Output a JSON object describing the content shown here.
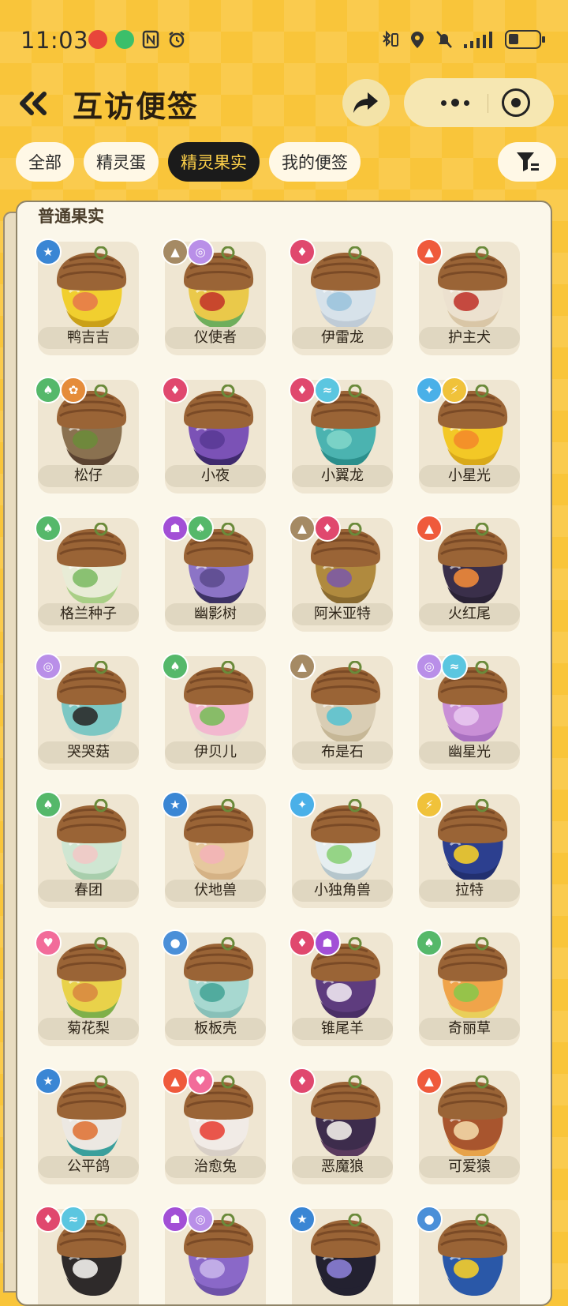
{
  "status_bar": {
    "time": "11:03"
  },
  "nav": {
    "title": "互访便签"
  },
  "tabs": [
    {
      "label": "全部",
      "active": false
    },
    {
      "label": "精灵蛋",
      "active": false
    },
    {
      "label": "精灵果实",
      "active": true
    },
    {
      "label": "我的便签",
      "active": false
    }
  ],
  "section_title": "普通果实",
  "colors": {
    "grass": "#55b86a",
    "water": "#4a8fd8",
    "fire": "#ef5a3c",
    "normal": "#3a86d4",
    "ghost": "#a24fd6",
    "demon": "#e0486e",
    "ice": "#4ab0e8",
    "electric": "#f0c23a",
    "ground": "#a58a64",
    "wind": "#5bc6e0",
    "illusion": "#b98fe8",
    "cute": "#f26c9a",
    "mech": "#e58c3a"
  },
  "fruits": [
    {
      "name": "鸭吉吉",
      "types": [
        "normal"
      ],
      "body": "#f1cf2f",
      "mark": "#e77a4a",
      "bottom": "#caa018"
    },
    {
      "name": "仪使者",
      "types": [
        "ground",
        "illusion"
      ],
      "body": "#eac94a",
      "mark": "#c4382a",
      "bottom": "#6fae5c"
    },
    {
      "name": "伊雷龙",
      "types": [
        "demon"
      ],
      "body": "#d7e2ea",
      "mark": "#9cc4dd",
      "bottom": "#bfcbd6"
    },
    {
      "name": "护主犬",
      "types": [
        "fire"
      ],
      "body": "#ece1cf",
      "mark": "#c1392f",
      "bottom": "#d9c6a6"
    },
    {
      "name": "松仔",
      "types": [
        "grass",
        "mech"
      ],
      "body": "#8a7150",
      "mark": "#6c8b3a",
      "bottom": "#5b4331"
    },
    {
      "name": "小夜",
      "types": [
        "demon"
      ],
      "body": "#7b52b6",
      "mark": "#5a3a96",
      "bottom": "#3f2a6e"
    },
    {
      "name": "小翼龙",
      "types": [
        "demon",
        "wind"
      ],
      "body": "#4bb3b0",
      "mark": "#7fd5c9",
      "bottom": "#2b8f8c"
    },
    {
      "name": "小星光",
      "types": [
        "ice",
        "electric"
      ],
      "body": "#f3c826",
      "mark": "#f48b2a",
      "bottom": "#d9a91a"
    },
    {
      "name": "格兰种子",
      "types": [
        "grass"
      ],
      "body": "#e8ecd6",
      "mark": "#7fbd67",
      "bottom": "#a9cf86"
    },
    {
      "name": "幽影树",
      "types": [
        "ghost",
        "grass"
      ],
      "body": "#8c74c6",
      "mark": "#5d4d8f",
      "bottom": "#3d3266"
    },
    {
      "name": "阿米亚特",
      "types": [
        "ground",
        "demon"
      ],
      "body": "#b08a3e",
      "mark": "#7d5aa4",
      "bottom": "#8a6a2e"
    },
    {
      "name": "火红尾",
      "types": [
        "fire"
      ],
      "body": "#3a2f4a",
      "mark": "#f08a3a",
      "bottom": "#2a2236"
    },
    {
      "name": "哭哭菇",
      "types": [
        "illusion"
      ],
      "body": "#7cc7c3",
      "mark": "#2b2b2b",
      "bottom": "#e7e2d2"
    },
    {
      "name": "伊贝儿",
      "types": [
        "grass"
      ],
      "body": "#f2b8cf",
      "mark": "#7cbd5c",
      "bottom": "#e9e3d3"
    },
    {
      "name": "布是石",
      "types": [
        "ground"
      ],
      "body": "#d9cdb4",
      "mark": "#5bc3cf",
      "bottom": "#c6b796"
    },
    {
      "name": "幽星光",
      "types": [
        "illusion",
        "wind"
      ],
      "body": "#c98fd6",
      "mark": "#e8c6ef",
      "bottom": "#a970c0"
    },
    {
      "name": "春团",
      "types": [
        "grass"
      ],
      "body": "#cfe6d2",
      "mark": "#f1c9c7",
      "bottom": "#a8ceac"
    },
    {
      "name": "伏地兽",
      "types": [
        "normal"
      ],
      "body": "#e6c89e",
      "mark": "#f3b4b7",
      "bottom": "#d5b285"
    },
    {
      "name": "小独角兽",
      "types": [
        "ice"
      ],
      "body": "#e6eef0",
      "mark": "#8cd07a",
      "bottom": "#b5c6cc"
    },
    {
      "name": "拉特",
      "types": [
        "electric"
      ],
      "body": "#2c3f8f",
      "mark": "#f4cd2a",
      "bottom": "#223070"
    },
    {
      "name": "菊花梨",
      "types": [
        "cute"
      ],
      "body": "#e9d24a",
      "mark": "#d98a40",
      "bottom": "#7fb04a"
    },
    {
      "name": "板板壳",
      "types": [
        "water"
      ],
      "body": "#a7d8d0",
      "mark": "#48a698",
      "bottom": "#88c0b8"
    },
    {
      "name": "锥尾羊",
      "types": [
        "demon",
        "ghost"
      ],
      "body": "#5e3c7e",
      "mark": "#ede4f0",
      "bottom": "#4a2e66"
    },
    {
      "name": "奇丽草",
      "types": [
        "grass"
      ],
      "body": "#f0a44a",
      "mark": "#8cc74a",
      "bottom": "#e9cf5a"
    },
    {
      "name": "公平鸽",
      "types": [
        "normal"
      ],
      "body": "#ece8e2",
      "mark": "#e0763a",
      "bottom": "#3a9f9c"
    },
    {
      "name": "治愈兔",
      "types": [
        "fire",
        "cute"
      ],
      "body": "#f1ebe6",
      "mark": "#e8463a",
      "bottom": "#d8cfc6"
    },
    {
      "name": "恶魔狼",
      "types": [
        "demon"
      ],
      "body": "#3d2c4c",
      "mark": "#f0ece8",
      "bottom": "#5a3a5e"
    },
    {
      "name": "可爱猿",
      "types": [
        "fire"
      ],
      "body": "#a8552e",
      "mark": "#f2d6a6",
      "bottom": "#e7a34a"
    },
    {
      "name": "",
      "types": [
        "demon",
        "wind"
      ],
      "body": "#2e2a2a",
      "mark": "#f2f0ec",
      "bottom": "#2e2a2a"
    },
    {
      "name": "",
      "types": [
        "ghost",
        "illusion"
      ],
      "body": "#8a68c8",
      "mark": "#c6b4ea",
      "bottom": "#6e52a8"
    },
    {
      "name": "",
      "types": [
        "normal"
      ],
      "body": "#232130",
      "mark": "#8b7ed6",
      "bottom": "#232130"
    },
    {
      "name": "",
      "types": [
        "water"
      ],
      "body": "#2a58a8",
      "mark": "#f4cd2a",
      "bottom": "#2a58a8"
    }
  ]
}
